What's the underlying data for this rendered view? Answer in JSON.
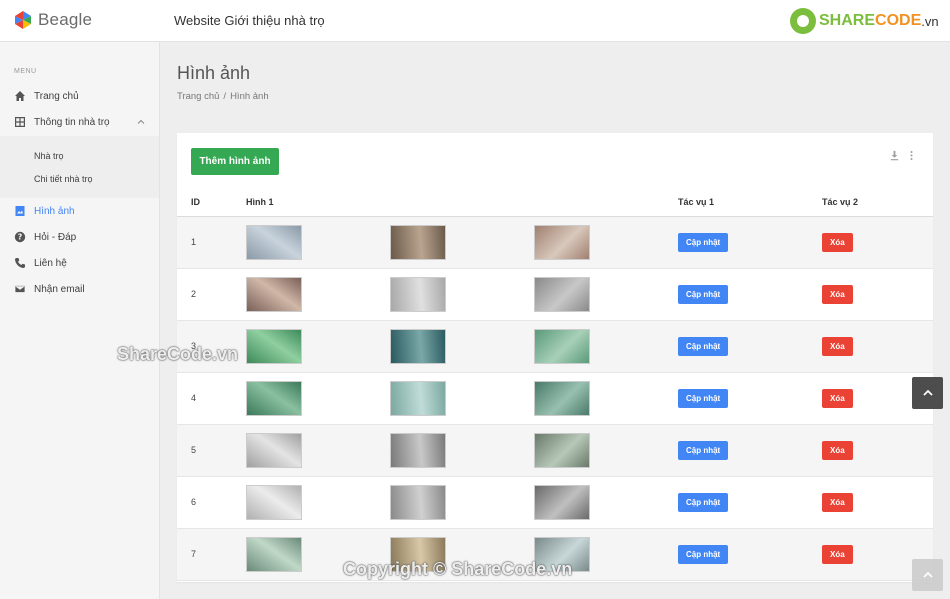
{
  "brand": {
    "name": "Beagle"
  },
  "header": {
    "site_title": "Website Giới thiệu nhà trọ",
    "logo_share": "SHARE",
    "logo_code": "CODE",
    "logo_vn": ".vn"
  },
  "sidebar": {
    "menu_label": "MENU",
    "items": [
      {
        "label": "Trang chủ",
        "icon": "home-icon"
      },
      {
        "label": "Thông tin nhà trọ",
        "icon": "grid-icon"
      },
      {
        "label": "Hình ảnh",
        "icon": "image-icon",
        "active": true
      },
      {
        "label": "Hỏi - Đáp",
        "icon": "help-icon"
      },
      {
        "label": "Liên hệ",
        "icon": "phone-icon"
      },
      {
        "label": "Nhận email",
        "icon": "mail-icon"
      }
    ],
    "submenu": [
      {
        "label": "Nhà trọ"
      },
      {
        "label": "Chi tiết nhà trọ"
      }
    ]
  },
  "page": {
    "title": "Hình ảnh",
    "breadcrumb": [
      "Trang chủ",
      "/",
      "Hình ảnh"
    ]
  },
  "toolbar": {
    "add_label": "Thêm hình ảnh"
  },
  "table": {
    "headers": {
      "id": "ID",
      "img1": "Hình 1",
      "img2": "",
      "img3": "",
      "act1": "Tác vụ 1",
      "act2": "Tác vụ 2"
    },
    "update_label": "Cập nhật",
    "delete_label": "Xóa",
    "rows": [
      {
        "id": "1"
      },
      {
        "id": "2"
      },
      {
        "id": "3"
      },
      {
        "id": "4"
      },
      {
        "id": "5"
      },
      {
        "id": "6"
      },
      {
        "id": "7"
      }
    ]
  },
  "watermarks": {
    "top": "ShareCode.vn",
    "bottom": "Copyright © ShareCode.vn"
  },
  "colors": {
    "accent": "#4285f4",
    "success": "#34a853",
    "danger": "#ea4335"
  }
}
